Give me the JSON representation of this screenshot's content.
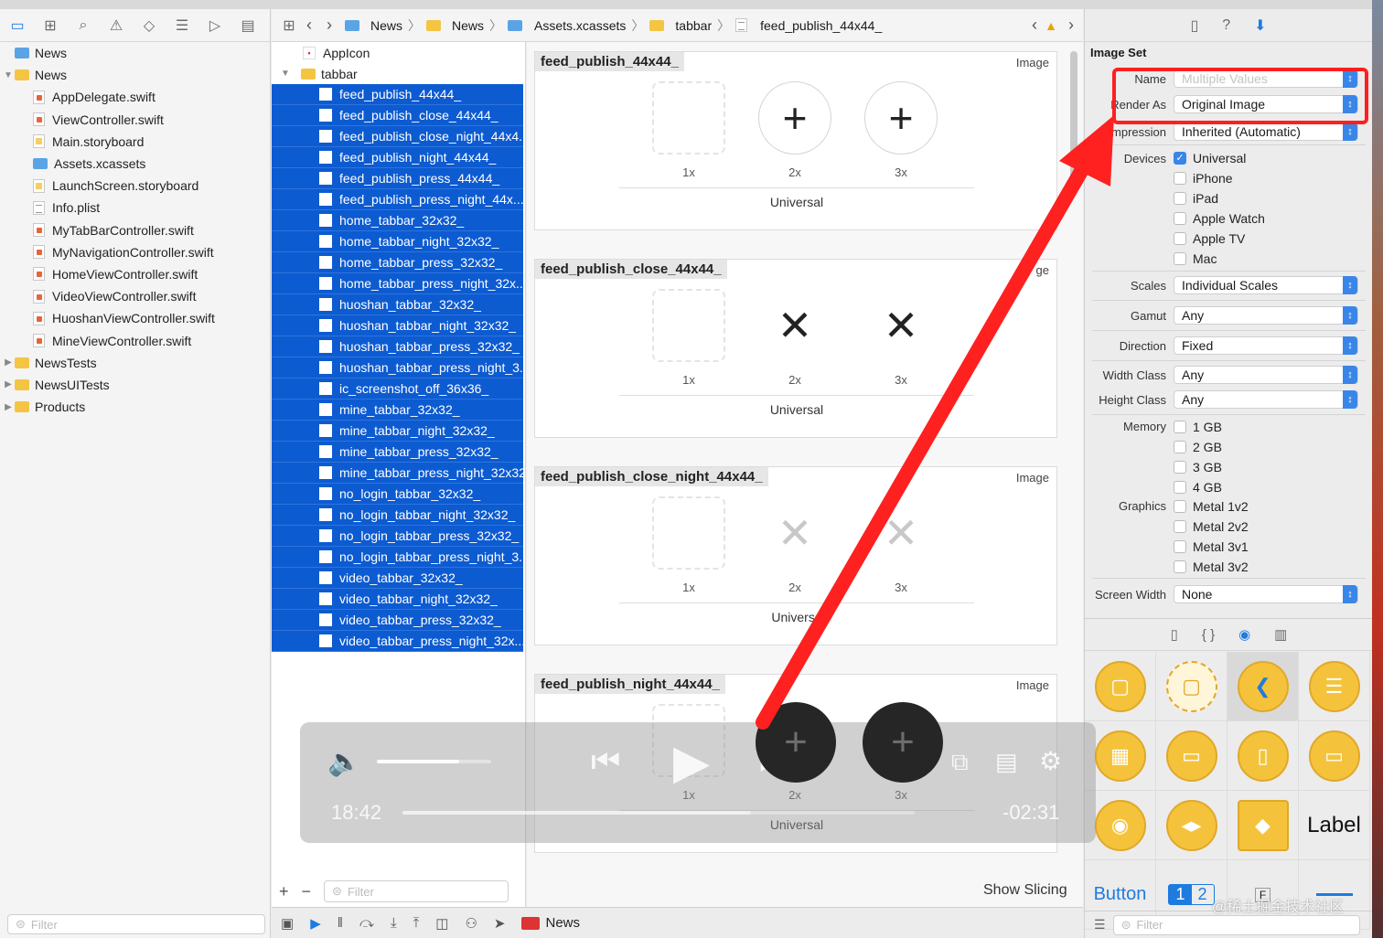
{
  "navigator": {
    "toolbar_icons": [
      "folder-icon",
      "hierarchy-icon",
      "search-icon",
      "warning-icon",
      "test-diamond-icon",
      "list-icon",
      "tag-icon",
      "comment-icon"
    ],
    "tree": [
      {
        "label": "News",
        "kind": "project",
        "depth": 0
      },
      {
        "label": "News",
        "kind": "folder",
        "depth": 0,
        "open": true
      },
      {
        "label": "AppDelegate.swift",
        "kind": "swift",
        "depth": 1
      },
      {
        "label": "ViewController.swift",
        "kind": "swift",
        "depth": 1
      },
      {
        "label": "Main.storyboard",
        "kind": "storyboard",
        "depth": 1
      },
      {
        "label": "Assets.xcassets",
        "kind": "xcassets",
        "depth": 1
      },
      {
        "label": "LaunchScreen.storyboard",
        "kind": "storyboard",
        "depth": 1
      },
      {
        "label": "Info.plist",
        "kind": "plist",
        "depth": 1
      },
      {
        "label": "MyTabBarController.swift",
        "kind": "swift",
        "depth": 1
      },
      {
        "label": "MyNavigationController.swift",
        "kind": "swift",
        "depth": 1
      },
      {
        "label": "HomeViewController.swift",
        "kind": "swift",
        "depth": 1
      },
      {
        "label": "VideoViewController.swift",
        "kind": "swift",
        "depth": 1
      },
      {
        "label": "HuoshanViewController.swift",
        "kind": "swift",
        "depth": 1
      },
      {
        "label": "MineViewController.swift",
        "kind": "swift",
        "depth": 1
      },
      {
        "label": "NewsTests",
        "kind": "folder",
        "depth": 0
      },
      {
        "label": "NewsUITests",
        "kind": "folder",
        "depth": 0
      },
      {
        "label": "Products",
        "kind": "folder",
        "depth": 0
      }
    ],
    "filter_placeholder": "Filter"
  },
  "jumpbar": {
    "crumbs": [
      "News",
      "News",
      "Assets.xcassets",
      "tabbar",
      "feed_publish_44x44_"
    ]
  },
  "assets": {
    "top": [
      {
        "label": "AppIcon"
      },
      {
        "label": "tabbar"
      }
    ],
    "selected": [
      "feed_publish_44x44_",
      "feed_publish_close_44x44_",
      "feed_publish_close_night_44x4...",
      "feed_publish_night_44x44_",
      "feed_publish_press_44x44_",
      "feed_publish_press_night_44x...",
      "home_tabbar_32x32_",
      "home_tabbar_night_32x32_",
      "home_tabbar_press_32x32_",
      "home_tabbar_press_night_32x...",
      "huoshan_tabbar_32x32_",
      "huoshan_tabbar_night_32x32_",
      "huoshan_tabbar_press_32x32_",
      "huoshan_tabbar_press_night_3...",
      "ic_screenshot_off_36x36_",
      "mine_tabbar_32x32_",
      "mine_tabbar_night_32x32_",
      "mine_tabbar_press_32x32_",
      "mine_tabbar_press_night_32x32_",
      "no_login_tabbar_32x32_",
      "no_login_tabbar_night_32x32_",
      "no_login_tabbar_press_32x32_",
      "no_login_tabbar_press_night_3...",
      "video_tabbar_32x32_",
      "video_tabbar_night_32x32_",
      "video_tabbar_press_32x32_",
      "video_tabbar_press_night_32x..."
    ],
    "filter_placeholder": "Filter"
  },
  "canvas": {
    "cards": [
      {
        "title": "feed_publish_44x44_",
        "type": "Image",
        "glyph": "+",
        "scales": [
          "1x",
          "2x",
          "3x"
        ],
        "idiom": "Universal"
      },
      {
        "title": "feed_publish_close_44x44_",
        "type": "ge",
        "glyph": "✕",
        "scales": [
          "1x",
          "2x",
          "3x"
        ],
        "idiom": "Universal"
      },
      {
        "title": "feed_publish_close_night_44x44_",
        "type": "Image",
        "glyph": "✕",
        "scales": [
          "1x",
          "2x",
          "3x"
        ],
        "idiom": "Universa"
      },
      {
        "title": "feed_publish_night_44x44_",
        "type": "Image",
        "glyph": "+",
        "scales": [
          "1x",
          "2x",
          "3x"
        ],
        "idiom": "Universal"
      }
    ],
    "show_slicing": "Show Slicing"
  },
  "player": {
    "elapsed": "18:42",
    "remaining": "-02:31",
    "volume_fraction": 0.72,
    "progress_fraction": 0.68
  },
  "bottombar": {
    "scheme": "News"
  },
  "inspector": {
    "section": "Image Set",
    "name_label": "Name",
    "name_placeholder": "Multiple Values",
    "render_as_label": "Render As",
    "render_as_value": "Original Image",
    "compression_label": "ompression",
    "compression_value": "Inherited (Automatic)",
    "devices_label": "Devices",
    "devices": [
      {
        "label": "Universal",
        "checked": true
      },
      {
        "label": "iPhone",
        "checked": false
      },
      {
        "label": "iPad",
        "checked": false
      },
      {
        "label": "Apple Watch",
        "checked": false
      },
      {
        "label": "Apple TV",
        "checked": false
      },
      {
        "label": "Mac",
        "checked": false
      }
    ],
    "scales_label": "Scales",
    "scales_value": "Individual Scales",
    "gamut_label": "Gamut",
    "gamut_value": "Any",
    "direction_label": "Direction",
    "direction_value": "Fixed",
    "width_class_label": "Width Class",
    "width_class_value": "Any",
    "height_class_label": "Height Class",
    "height_class_value": "Any",
    "memory_label": "Memory",
    "memory": [
      "1 GB",
      "2 GB",
      "3 GB",
      "4 GB"
    ],
    "graphics_label": "Graphics",
    "graphics": [
      "Metal 1v2",
      "Metal 2v2",
      "Metal 3v1",
      "Metal 3v2"
    ],
    "screen_width_label": "Screen Width",
    "screen_width_value": "None",
    "library_label": "Label",
    "library_button": "Button",
    "library_seg_1": "1",
    "library_seg_2": "2",
    "filter_placeholder": "Filter"
  },
  "watermark": "@稀土掘金技术社区",
  "colors": {
    "selection": "#0d5bd1",
    "accent": "#3a86e8",
    "annotation": "#ff1f1f",
    "library": "#f5c33b"
  }
}
